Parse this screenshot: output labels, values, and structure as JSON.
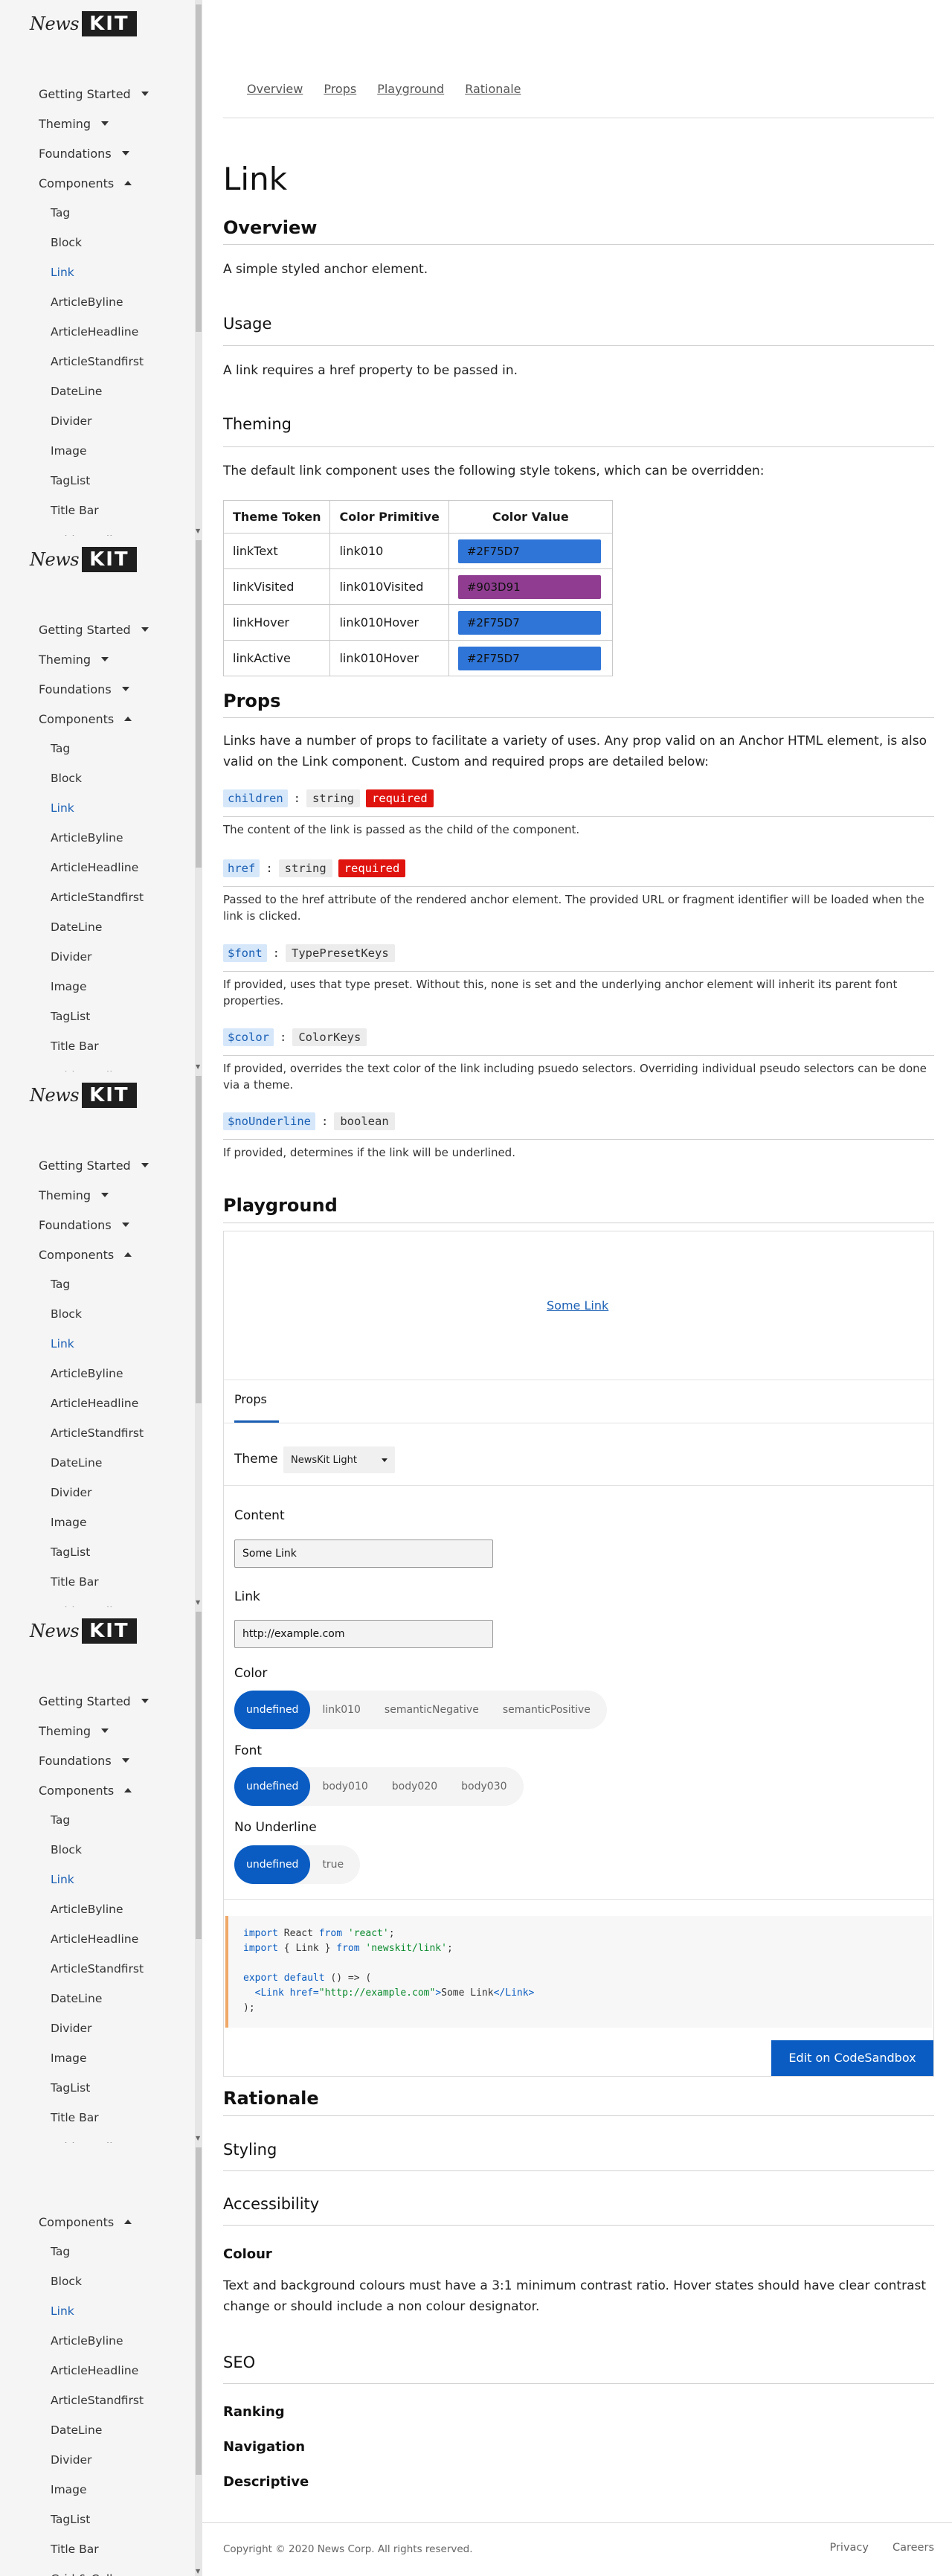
{
  "brand": {
    "news": "News",
    "kit": "KIT"
  },
  "sidebar": {
    "top_items": [
      {
        "label": "Getting Started",
        "caret": "down"
      },
      {
        "label": "Theming",
        "caret": "down"
      },
      {
        "label": "Foundations",
        "caret": "down"
      },
      {
        "label": "Components",
        "caret": "up"
      }
    ],
    "sub_items": [
      "Tag",
      "Block",
      "Link",
      "ArticleByline",
      "ArticleHeadline",
      "ArticleStandfirst",
      "DateLine",
      "Divider",
      "Image",
      "TagList",
      "Title Bar",
      "Grid & Cell"
    ],
    "active_item": "Link"
  },
  "page_nav": [
    "Overview",
    "Props",
    "Playground",
    "Rationale"
  ],
  "title": "Link",
  "overview": {
    "heading": "Overview",
    "text": "A simple styled anchor element.",
    "usage_heading": "Usage",
    "usage_text": "A link requires a href property to be passed in.",
    "theming_heading": "Theming",
    "theming_text": "The default link component uses the following style tokens, which can be overridden:"
  },
  "tokens_table": {
    "headers": [
      "Theme Token",
      "Color Primitive",
      "Color Value"
    ],
    "rows": [
      {
        "token": "linkText",
        "primitive": "link010",
        "value": "#2F75D7",
        "color": "#2F75D7"
      },
      {
        "token": "linkVisited",
        "primitive": "link010Visited",
        "value": "#903D91",
        "color": "#903D91"
      },
      {
        "token": "linkHover",
        "primitive": "link010Hover",
        "value": "#2F75D7",
        "color": "#2F75D7"
      },
      {
        "token": "linkActive",
        "primitive": "link010Hover",
        "value": "#2F75D7",
        "color": "#2F75D7"
      }
    ]
  },
  "props": {
    "heading": "Props",
    "intro": "Links have a number of props to facilitate a variety of uses. Any prop valid on an Anchor HTML element, is also valid on the Link component. Custom and required props are detailed below:",
    "items": [
      {
        "name": "children",
        "type": "string",
        "required": "required",
        "desc": "The content of the link is passed as the child of the component."
      },
      {
        "name": "href",
        "type": "string",
        "required": "required",
        "desc": "Passed to the href attribute of the rendered anchor element. The provided URL or fragment identifier will be loaded when the link is clicked."
      },
      {
        "name": "$font",
        "type": "TypePresetKeys",
        "desc": "If provided, uses that type preset. Without this, none is set and the underlying anchor element will inherit its parent font properties."
      },
      {
        "name": "$color",
        "type": "ColorKeys",
        "desc": "If provided, overrides the text color of the link including psuedo selectors. Overriding individual pseudo selectors can be done via a theme."
      },
      {
        "name": "$noUnderline",
        "type": "boolean",
        "desc": "If provided, determines if the link will be underlined."
      }
    ]
  },
  "playground": {
    "heading": "Playground",
    "preview_link": "Some Link",
    "tab": "Props",
    "theme_label": "Theme",
    "theme_value": "NewsKit Light",
    "content_label": "Content",
    "content_value": "Some Link",
    "link_label": "Link",
    "link_value": "http://example.com",
    "color_label": "Color",
    "color_options": [
      "undefined",
      "link010",
      "semanticNegative",
      "semanticPositive"
    ],
    "font_label": "Font",
    "font_options": [
      "undefined",
      "body010",
      "body020",
      "body030"
    ],
    "underline_label": "No Underline",
    "underline_options": [
      "undefined",
      "true"
    ],
    "code": {
      "l1_kw": "import",
      "l1_mid": " React ",
      "l1_from": "from",
      "l1_str": "'react'",
      "l1_end": ";",
      "l2_kw": "import",
      "l2_mid": " { Link } ",
      "l2_from": "from",
      "l2_str": "'newskit/link'",
      "l2_end": ";",
      "l4_kw": "export default",
      "l4_rest": " () => (",
      "l5_open": "<Link ",
      "l5_attr": "href=",
      "l5_str": "\"http://example.com\"",
      "l5_gt": ">",
      "l5_text": "Some Link",
      "l5_close": "</Link>",
      "l6": ");"
    },
    "sandbox_button": "Edit on CodeSandbox"
  },
  "rationale": {
    "heading": "Rationale",
    "styling": "Styling",
    "accessibility": "Accessibility",
    "colour_heading": "Colour",
    "colour_text": "Text and background colours must have a 3:1 minimum contrast ratio. Hover states should have clear contrast change or should include a non colour designator.",
    "seo": "SEO",
    "ranking": "Ranking",
    "navigation": "Navigation",
    "descriptive": "Descriptive"
  },
  "footer": {
    "copyright": "Copyright © 2020 News Corp. All rights reserved.",
    "links": [
      "Privacy",
      "Careers"
    ]
  },
  "colors": {
    "accent": "#0a5cc2",
    "required": "#e0140f",
    "sidebar_bg": "#f5f5f5"
  }
}
